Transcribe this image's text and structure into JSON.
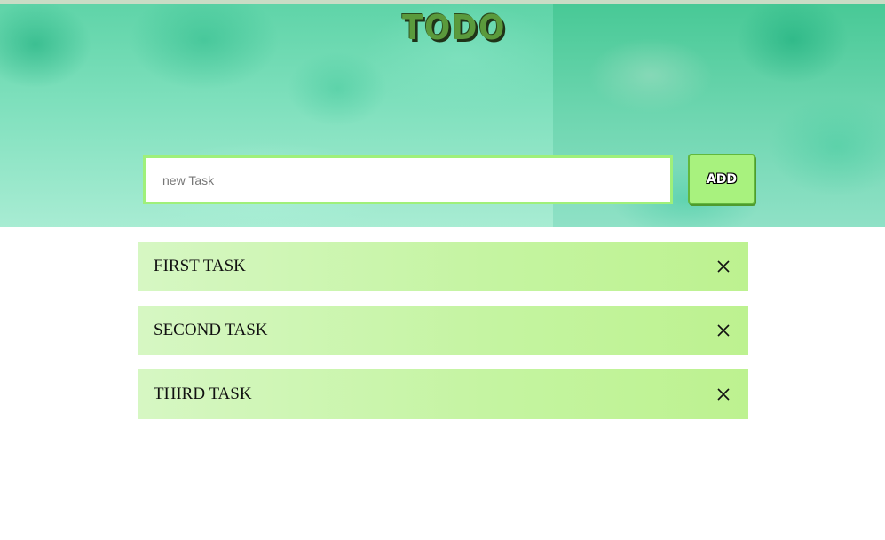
{
  "header": {
    "title": "TODO"
  },
  "new_task": {
    "placeholder": "new Task",
    "value": "",
    "add_label": "ADD"
  },
  "tasks": [
    {
      "label": "FIRST TASK",
      "remove_icon": "close-icon"
    },
    {
      "label": "SECOND TASK",
      "remove_icon": "close-icon"
    },
    {
      "label": "THIRD TASK",
      "remove_icon": "close-icon"
    }
  ],
  "colors": {
    "accent": "#a8f27e",
    "input_border": "#9ff07a",
    "task_bg": "#c4f4a0",
    "title": "#5a9a3c"
  }
}
